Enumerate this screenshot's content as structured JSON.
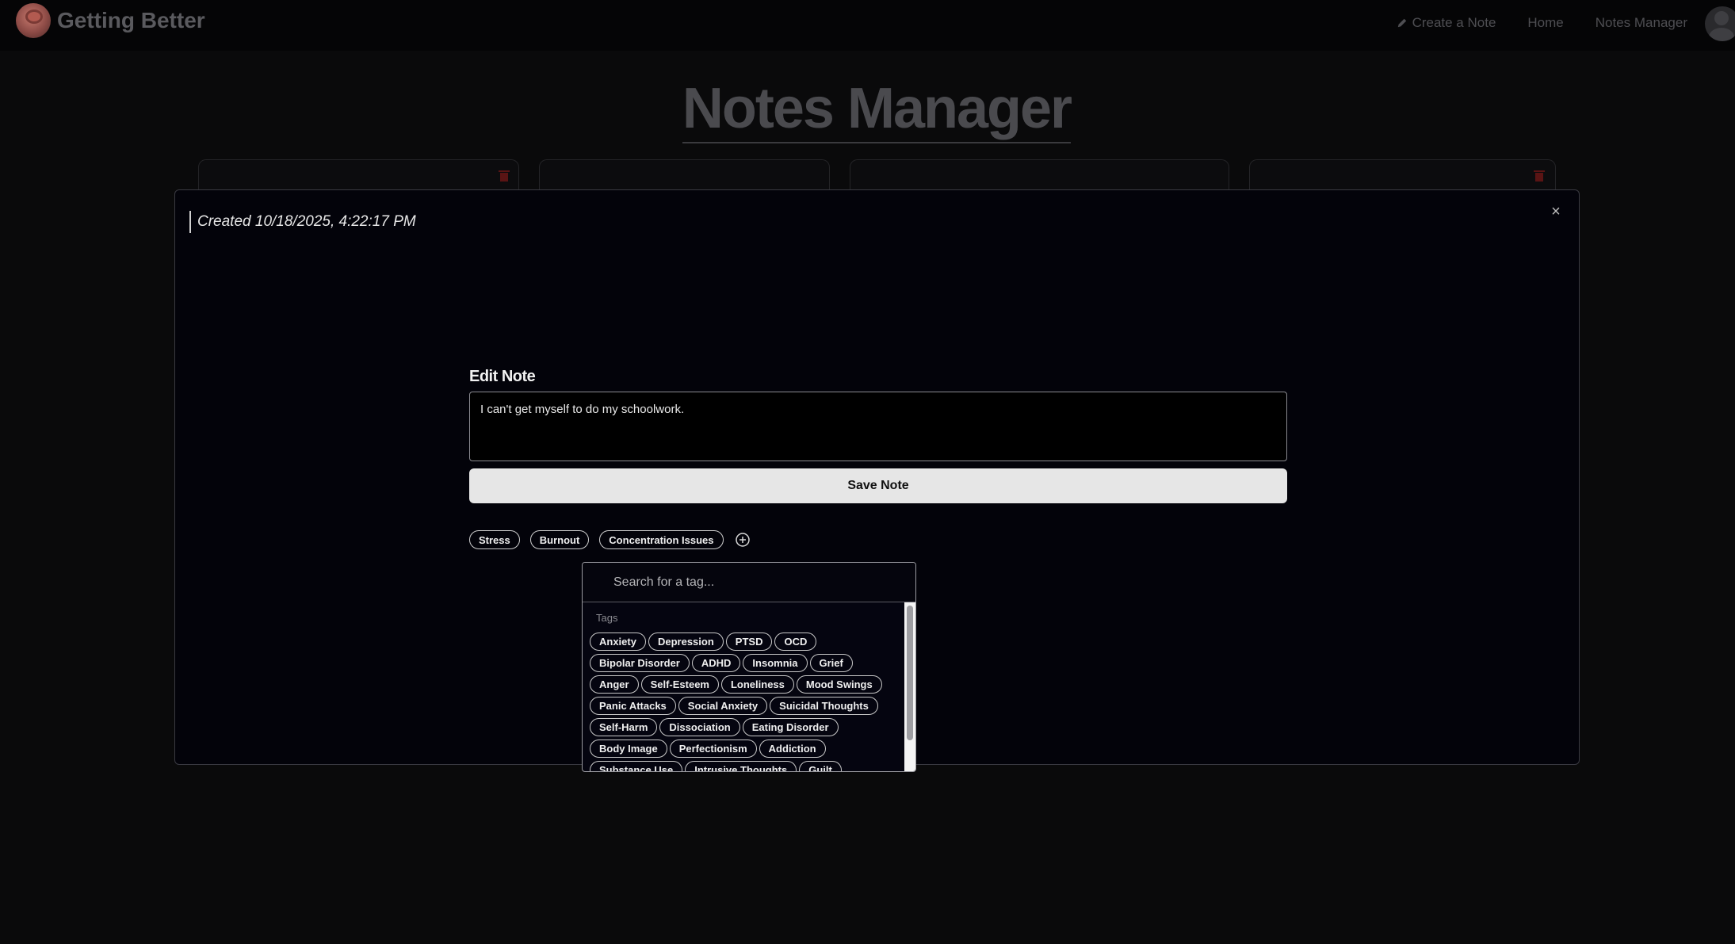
{
  "navbar": {
    "brand": "Getting Better",
    "links": {
      "create": "Create a Note",
      "home": "Home",
      "manager": "Notes Manager"
    }
  },
  "page": {
    "title": "Notes Manager"
  },
  "modal": {
    "created": "Created 10/18/2025, 4:22:17 PM",
    "close_symbol": "×",
    "edit_label": "Edit Note",
    "note_text": "I can't get myself to do my schoolwork.",
    "save_label": "Save Note",
    "selected_tags": [
      "Stress",
      "Burnout",
      "Concentration Issues"
    ],
    "add_tag_icon": "plus-circle-icon"
  },
  "dropdown": {
    "search_placeholder": "Search for a tag...",
    "heading": "Tags",
    "rows": [
      [
        "Anxiety",
        "Depression",
        "PTSD",
        "OCD"
      ],
      [
        "Bipolar Disorder",
        "ADHD",
        "Insomnia",
        "Grief"
      ],
      [
        "Anger",
        "Self-Esteem",
        "Loneliness",
        "Mood Swings"
      ],
      [
        "Panic Attacks",
        "Social Anxiety",
        "Suicidal Thoughts"
      ],
      [
        "Self-Harm",
        "Dissociation",
        "Eating Disorder"
      ],
      [
        "Body Image",
        "Perfectionism",
        "Addiction"
      ],
      [
        "Substance Use",
        "Intrusive Thoughts",
        "Guilt"
      ]
    ]
  },
  "colors": {
    "background": "#0a0a0b",
    "modal_bg": "#03030a",
    "save_button": "#e6e6e6",
    "trash_red": "#7a1a1a"
  }
}
